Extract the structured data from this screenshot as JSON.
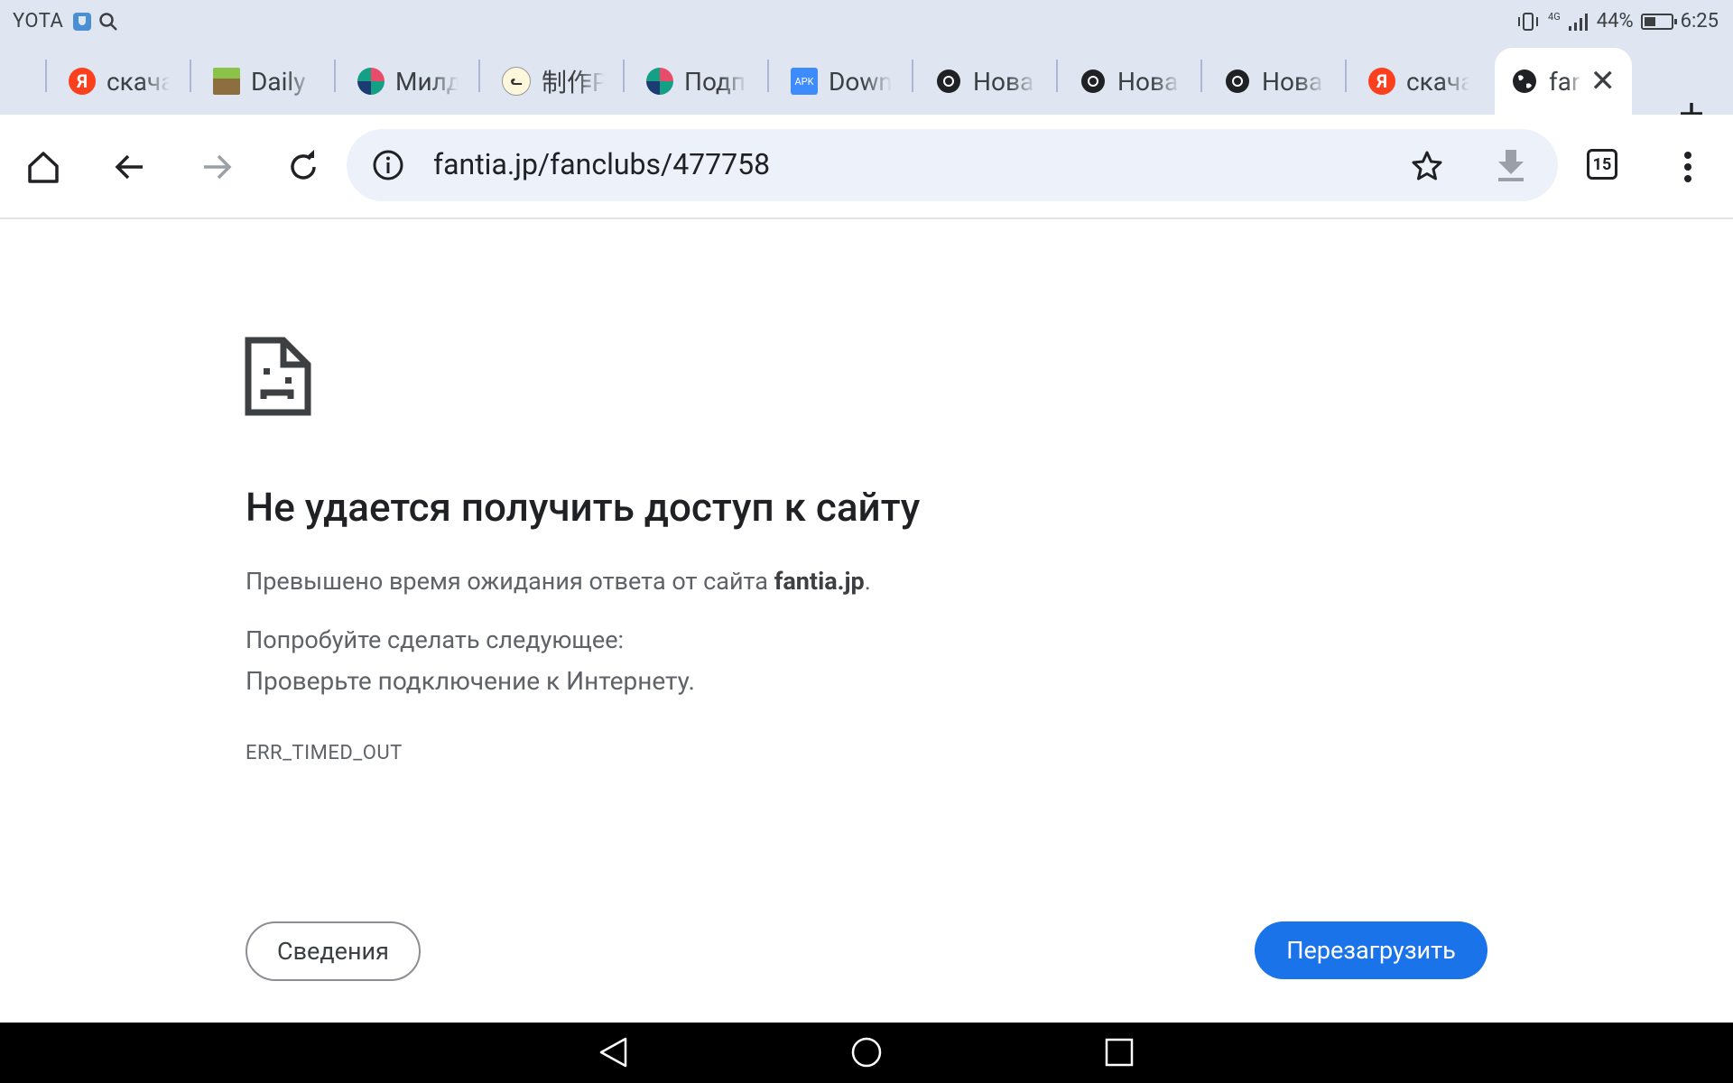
{
  "status_bar": {
    "carrier": "YOTA",
    "network": "4G",
    "battery_percent": "44%",
    "battery_level": 0.44,
    "time": "6:25"
  },
  "tabs": [
    {
      "title": "скача",
      "favicon": "yandex-icon",
      "color": "#fc3f1d"
    },
    {
      "title": "Daily",
      "favicon": "minecraft-icon",
      "color": "#6aa84f"
    },
    {
      "title": "Милд",
      "favicon": "pinwheel-icon",
      "color": "#14a085"
    },
    {
      "title": "制作P",
      "favicon": "cat-doodle-icon",
      "color": "#f2d37a"
    },
    {
      "title": "Подп",
      "favicon": "pinwheel-icon",
      "color": "#14a085"
    },
    {
      "title": "Down",
      "favicon": "apk-icon",
      "color": "#3d8bfd"
    },
    {
      "title": "Нова",
      "favicon": "chrome-icon",
      "color": "#202124"
    },
    {
      "title": "Нова",
      "favicon": "chrome-icon",
      "color": "#202124"
    },
    {
      "title": "Нова",
      "favicon": "chrome-icon",
      "color": "#202124"
    },
    {
      "title": "скача",
      "favicon": "yandex-icon",
      "color": "#fc3f1d"
    },
    {
      "title": "far",
      "favicon": "globe-icon",
      "color": "#202124",
      "active": true
    }
  ],
  "toolbar": {
    "url": "fantia.jp/fanclubs/477758",
    "tab_count": "15"
  },
  "error": {
    "title": "Не удается получить доступ к сайту",
    "desc_prefix": "Превышено время ожидания ответа от сайта ",
    "host": "fantia.jp",
    "desc_suffix": ".",
    "try_label": "Попробуйте сделать следующее:",
    "suggestion": "Проверьте подключение к Интернету.",
    "code": "ERR_TIMED_OUT",
    "details_button": "Сведения",
    "reload_button": "Перезагрузить"
  },
  "colors": {
    "accent": "#1a73e8",
    "chrome_bg": "#dfe5f1",
    "omnibox_bg": "#edf1f9"
  }
}
